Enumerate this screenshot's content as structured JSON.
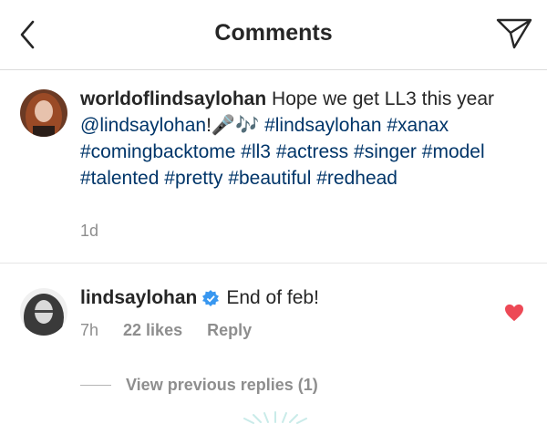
{
  "header": {
    "title": "Comments",
    "back_icon": "chevron-left-icon",
    "send_icon": "paper-plane-icon"
  },
  "caption": {
    "username": "worldoflindsaylohan",
    "text_before_mention": "Hope we get LL3 this year ",
    "mention": "@lindsaylohan",
    "after_mention": "!",
    "emoji_mic": "🎤",
    "emoji_notes": "🎶",
    "hashtags": [
      "#lindsaylohan",
      "#xanax",
      "#comingbacktome",
      "#ll3",
      "#actress",
      "#singer",
      "#model",
      "#talented",
      "#pretty",
      "#beautiful",
      "#redhead"
    ],
    "time": "1d"
  },
  "reply": {
    "username": "lindsaylohan",
    "verified_icon": "verified-badge-icon",
    "text": "End of feb!",
    "time": "7h",
    "likes": "22 likes",
    "reply_label": "Reply",
    "heart_icon": "heart-filled-icon",
    "heart_color": "#ed4956"
  },
  "view_replies": "View previous replies (1)",
  "colors": {
    "link": "#003569",
    "muted": "#8e8e8e",
    "text": "#262626",
    "verified": "#3897f0"
  }
}
